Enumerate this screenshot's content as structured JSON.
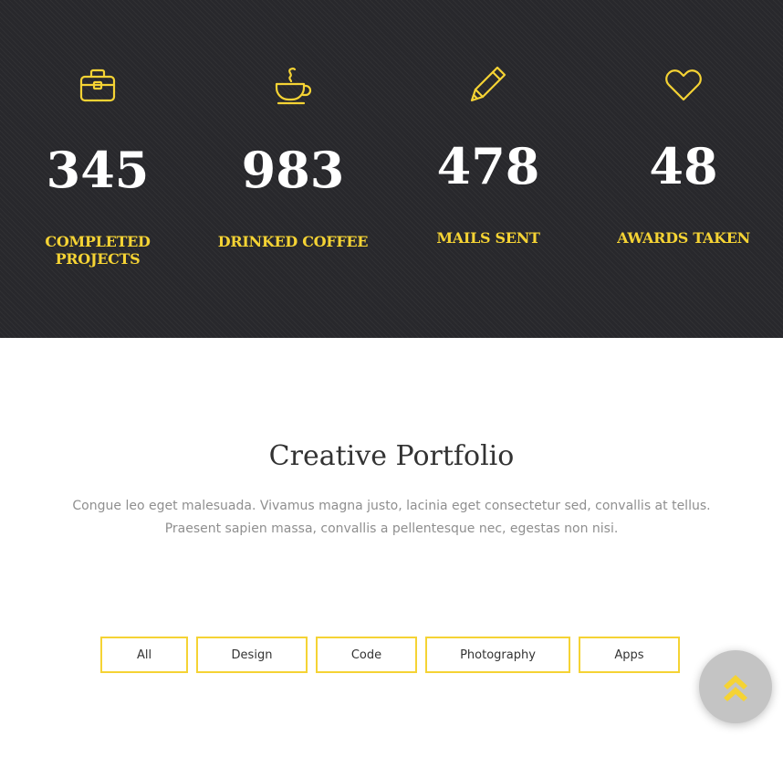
{
  "stats": [
    {
      "icon": "briefcase-icon",
      "number": "345",
      "label_line1": "COMPLETED",
      "label_line2": "PROJECTS"
    },
    {
      "icon": "coffee-cup-icon",
      "number": "983",
      "label_line1": "DRINKED COFFEE",
      "label_line2": ""
    },
    {
      "icon": "pencil-icon",
      "number": "478",
      "label_line1": "MAILS SENT",
      "label_line2": ""
    },
    {
      "icon": "heart-icon",
      "number": "48",
      "label_line1": "AWARDS TAKEN",
      "label_line2": ""
    }
  ],
  "portfolio": {
    "title": "Creative Portfolio",
    "description_line1": "Congue leo eget malesuada. Vivamus magna justo, lacinia eget consectetur sed, convallis at tellus.",
    "description_line2": "Praesent sapien massa, convallis a pellentesque nec, egestas non nisi."
  },
  "filters": [
    "All",
    "Design",
    "Code",
    "Photography",
    "Apps"
  ],
  "scroll_top": {
    "icon": "double-chevron-up-icon"
  },
  "colors": {
    "accent": "#f5d334",
    "dark_band": "#28282c",
    "heading": "#333333",
    "body_text": "#8f8f8f"
  }
}
